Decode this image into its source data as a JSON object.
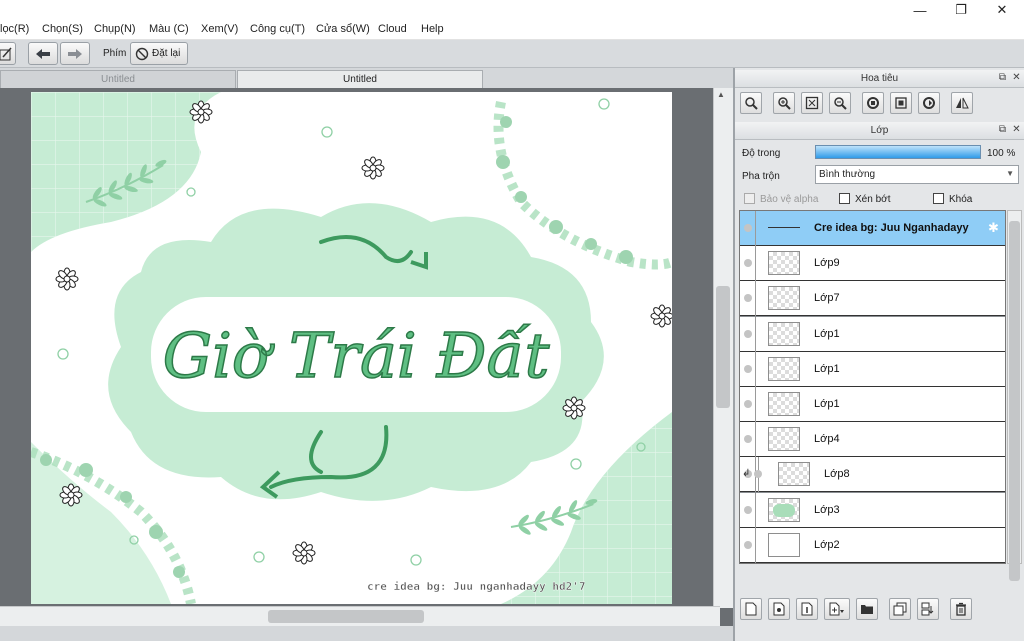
{
  "window": {
    "minimize_glyph": "—",
    "maximize_glyph": "❐",
    "close_glyph": "✕"
  },
  "menu": [
    "lọc(R)",
    "Chọn(S)",
    "Chụp(N)",
    "Màu (C)",
    "Xem(V)",
    "Công cụ(T)",
    "Cửa sổ(W)",
    "Cloud",
    "Help"
  ],
  "toolbar": {
    "key_label": "Phím",
    "reset_label": "Đặt lại",
    "undo_icon": "undo-icon",
    "redo_icon": "redo-icon"
  },
  "tabs": [
    {
      "label": "Untitled",
      "active": false
    },
    {
      "label": "Untitled",
      "active": true
    }
  ],
  "artwork": {
    "title": "Giờ Trái Đất",
    "credit": "cre idea bg: Juu   nganhadayy   hd2'7",
    "palette": {
      "mint": "#c6ecd4",
      "mint_dark": "#a8ddb9",
      "green": "#3d9a5e",
      "green_dark": "#2d7a48"
    }
  },
  "navigator": {
    "title": "Hoa tiêu"
  },
  "layers_panel": {
    "title": "Lớp",
    "opacity_label": "Độ trong",
    "opacity_value": "100 %",
    "opacity_fraction": 1.0,
    "blend_label": "Pha trộn",
    "blend_value": "Bình thường",
    "protect_alpha_label": "Bảo vệ alpha",
    "clip_label": "Xén bớt",
    "lock_label": "Khóa",
    "layers": [
      {
        "name": "Cre idea bg: Juu   Nganhadayy",
        "selected": true,
        "thumb": "line"
      },
      {
        "name": "Lớp9",
        "selected": false,
        "thumb": "checker"
      },
      {
        "name": "Lớp7",
        "selected": false,
        "thumb": "checker"
      },
      {
        "name": "Lớp1",
        "selected": false,
        "thumb": "checker"
      },
      {
        "name": "Lớp1",
        "selected": false,
        "thumb": "checker"
      },
      {
        "name": "Lớp1",
        "selected": false,
        "thumb": "checker"
      },
      {
        "name": "Lớp4",
        "selected": false,
        "thumb": "checker"
      },
      {
        "name": "Lớp8",
        "selected": false,
        "thumb": "checker",
        "clipped": true
      },
      {
        "name": "Lớp3",
        "selected": false,
        "thumb": "mint"
      },
      {
        "name": "Lớp2",
        "selected": false,
        "thumb": "white"
      }
    ]
  }
}
